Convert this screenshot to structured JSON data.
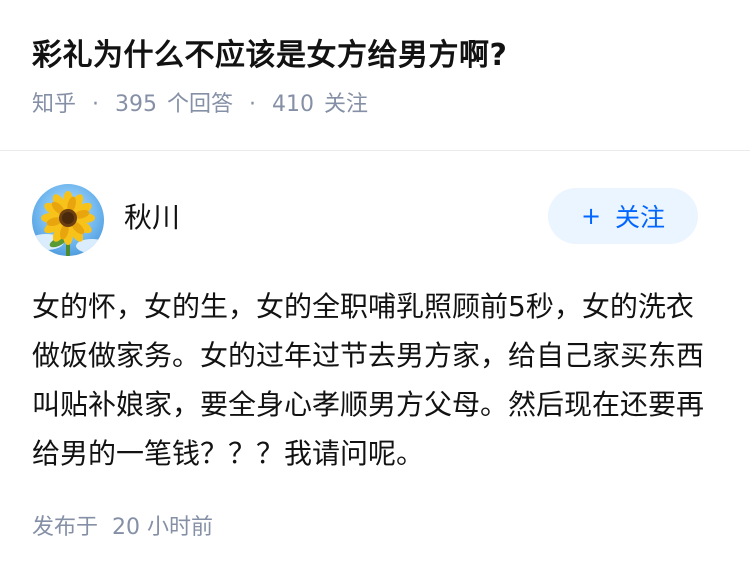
{
  "question": {
    "title": "彩礼为什么不应该是女方给男方啊?",
    "source": "知乎",
    "separator": "·",
    "answer_count": "395",
    "answer_label": "个回答",
    "follower_count": "410",
    "follower_label": "关注"
  },
  "author": {
    "name": "秋川",
    "avatar_icon": "sunflower-avatar",
    "follow_plus": "+",
    "follow_label": "关注"
  },
  "answer": {
    "content": "女的怀，女的生，女的全职哺乳照顾前5秒，女的洗衣做饭做家务。女的过年过节去男方家，给自己家买东西叫贴补娘家，要全身心孝顺男方父母。然后现在还要再给男的一笔钱？？？我请问呢。"
  },
  "footer": {
    "publish_label": "发布于",
    "publish_time": "20 小时前"
  },
  "colors": {
    "title": "#121212",
    "meta": "#8590a6",
    "accent": "#0066ff",
    "follow_bg": "#ebf5ff",
    "divider": "#ebebeb"
  }
}
